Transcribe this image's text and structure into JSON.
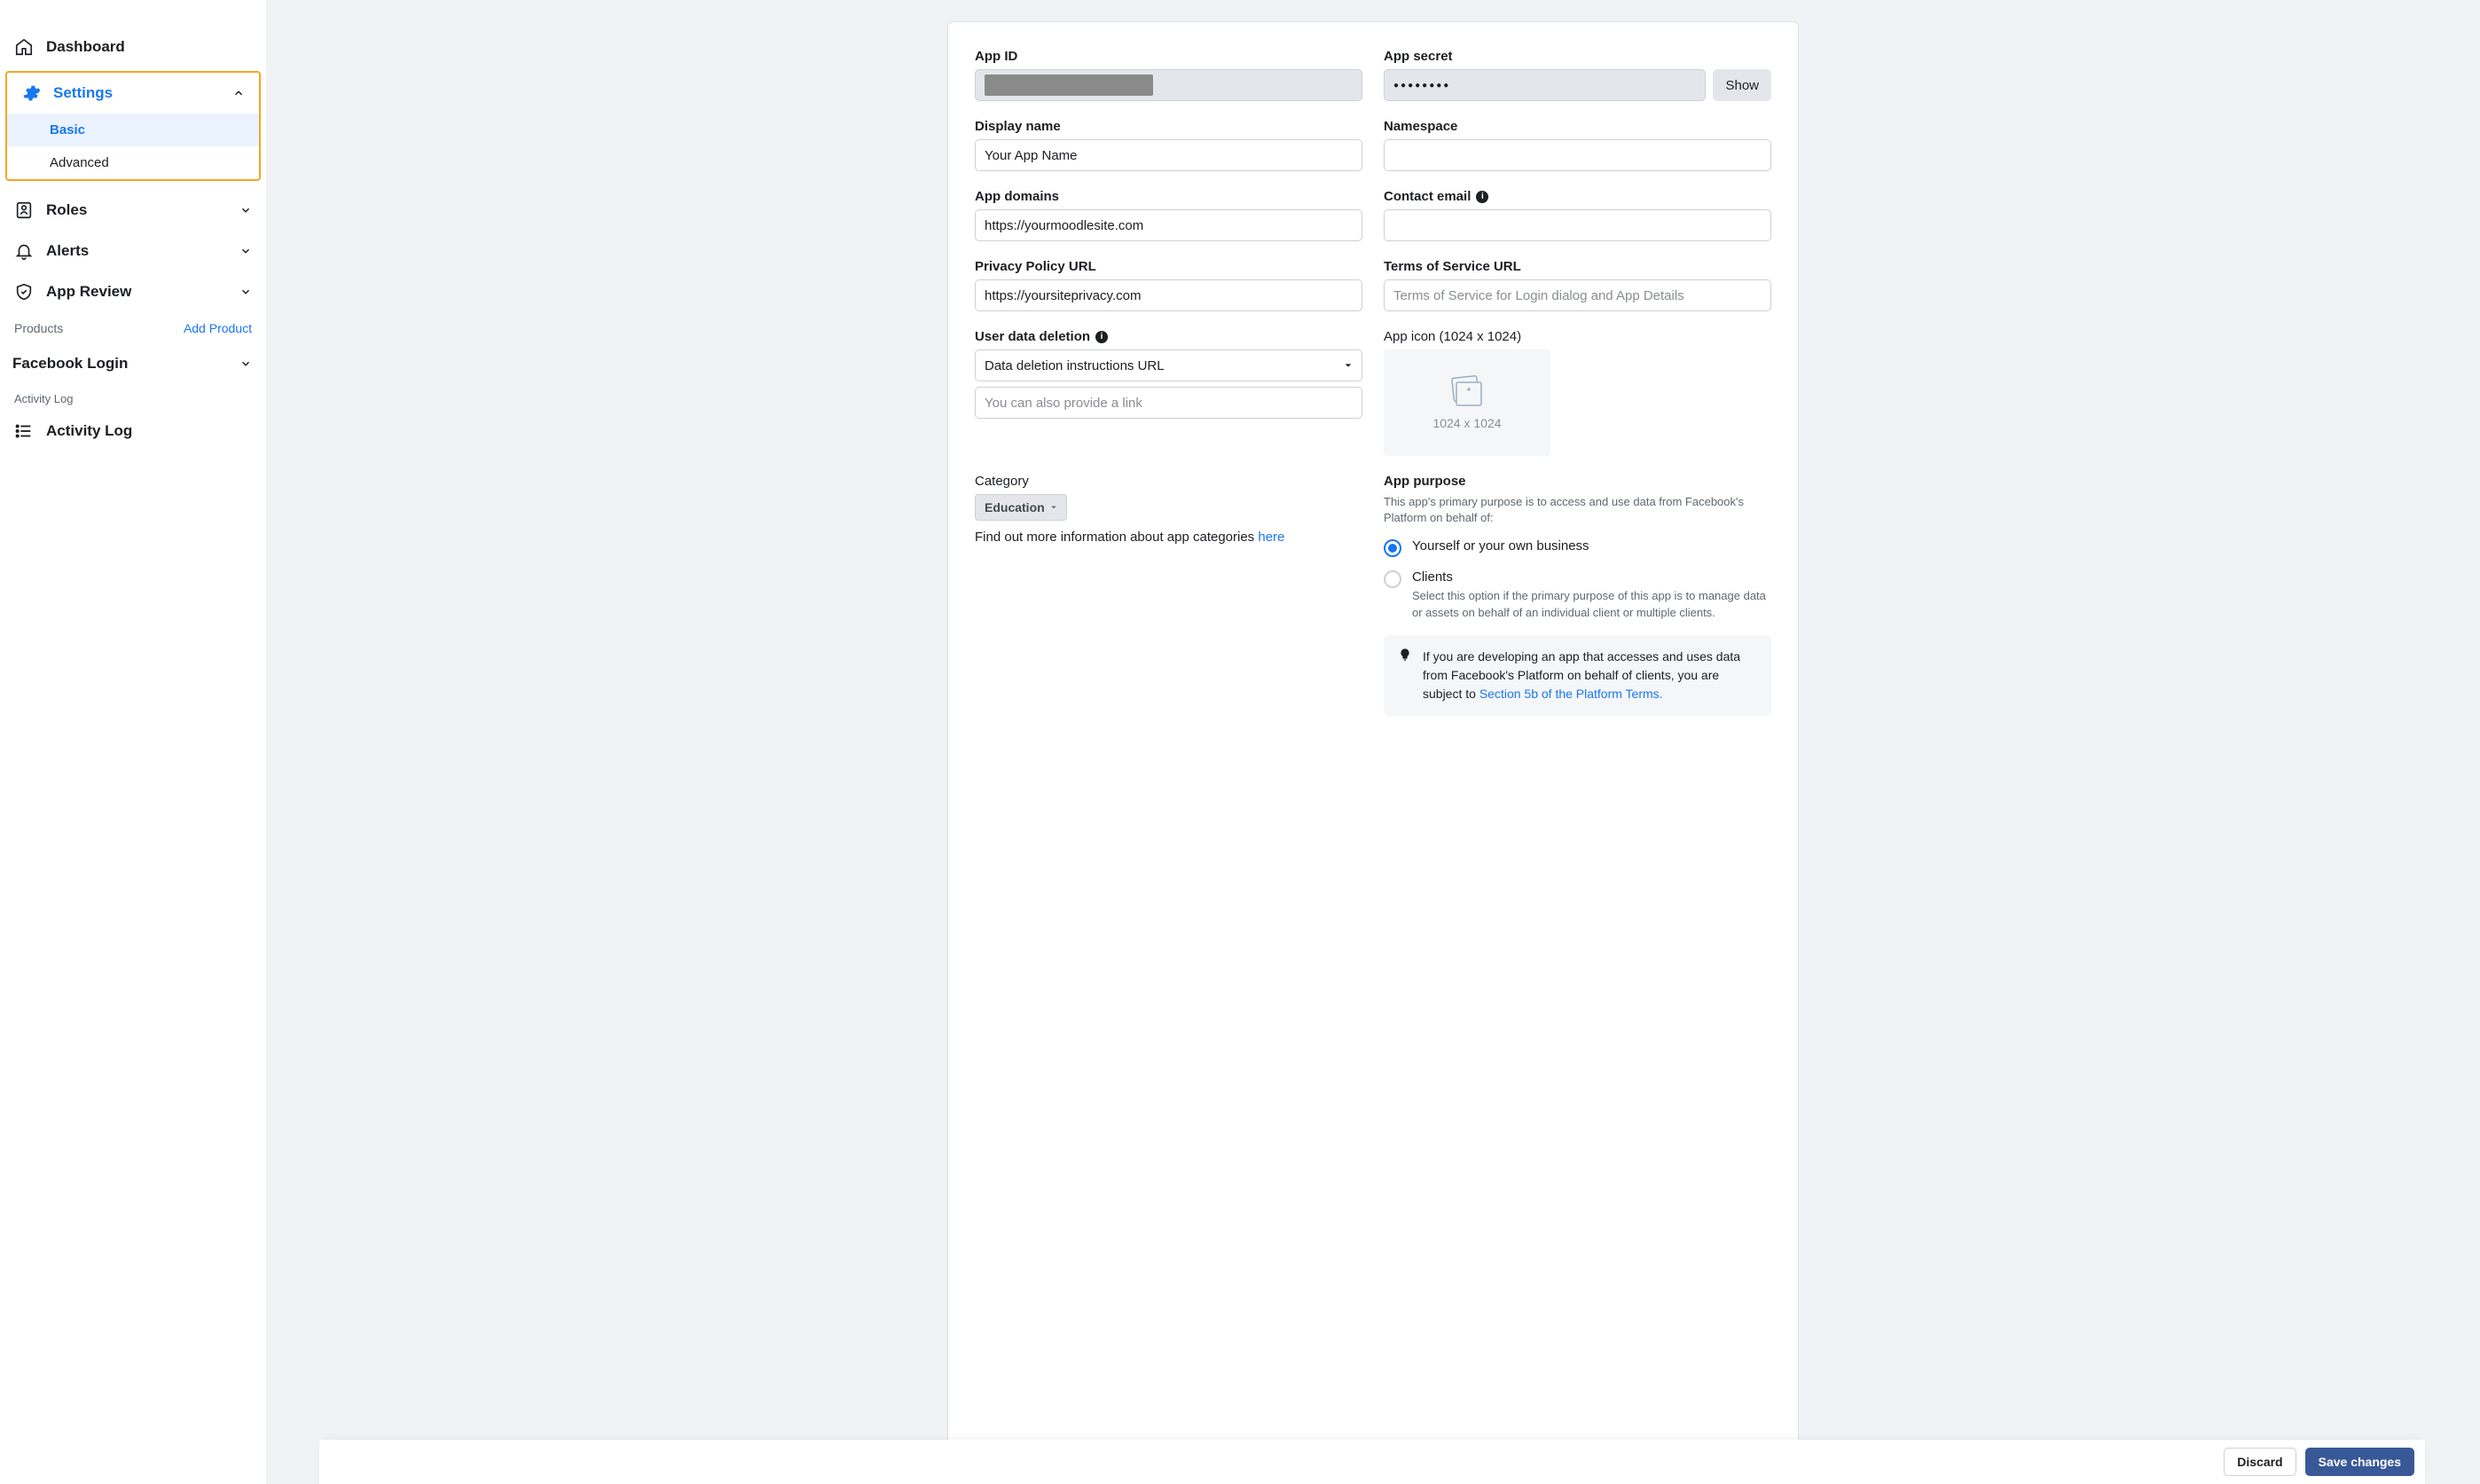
{
  "sidebar": {
    "dashboard": "Dashboard",
    "settings": "Settings",
    "settings_basic": "Basic",
    "settings_advanced": "Advanced",
    "roles": "Roles",
    "alerts": "Alerts",
    "app_review": "App Review",
    "products_head": "Products",
    "add_product": "Add Product",
    "facebook_login": "Facebook Login",
    "activity_log_head": "Activity Log",
    "activity_log": "Activity Log"
  },
  "form": {
    "app_id_label": "App ID",
    "app_secret_label": "App secret",
    "app_secret_value": "●●●●●●●●",
    "show_btn": "Show",
    "display_name_label": "Display name",
    "display_name_value": "Your App Name",
    "namespace_label": "Namespace",
    "app_domains_label": "App domains",
    "app_domains_value": "https://yourmoodlesite.com",
    "contact_email_label": "Contact email",
    "privacy_url_label": "Privacy Policy URL",
    "privacy_url_value": "https://yoursiteprivacy.com",
    "tos_url_label": "Terms of Service URL",
    "tos_placeholder": "Terms of Service for Login dialog and App Details",
    "user_data_deletion_label": "User data deletion",
    "user_data_deletion_select": "Data deletion instructions URL",
    "user_data_deletion_link_placeholder": "You can also provide a link",
    "app_icon_label": "App icon (1024 x 1024)",
    "app_icon_dim": "1024 x 1024",
    "category_label": "Category",
    "category_value": "Education",
    "find_more_text": "Find out more information about app categories ",
    "find_more_link": "here",
    "app_purpose_label": "App purpose",
    "app_purpose_desc": "This app's primary purpose is to access and use data from Facebook's Platform on behalf of:",
    "purpose_option1": "Yourself or your own business",
    "purpose_option2_title": "Clients",
    "purpose_option2_desc": "Select this option if the primary purpose of this app is to manage data or assets on behalf of an individual client or multiple clients.",
    "tip_text": "If you are developing an app that accesses and uses data from Facebook's Platform on behalf of clients, you are subject to ",
    "tip_link": "Section 5b of the Platform Terms."
  },
  "footer": {
    "discard": "Discard",
    "save": "Save changes"
  }
}
